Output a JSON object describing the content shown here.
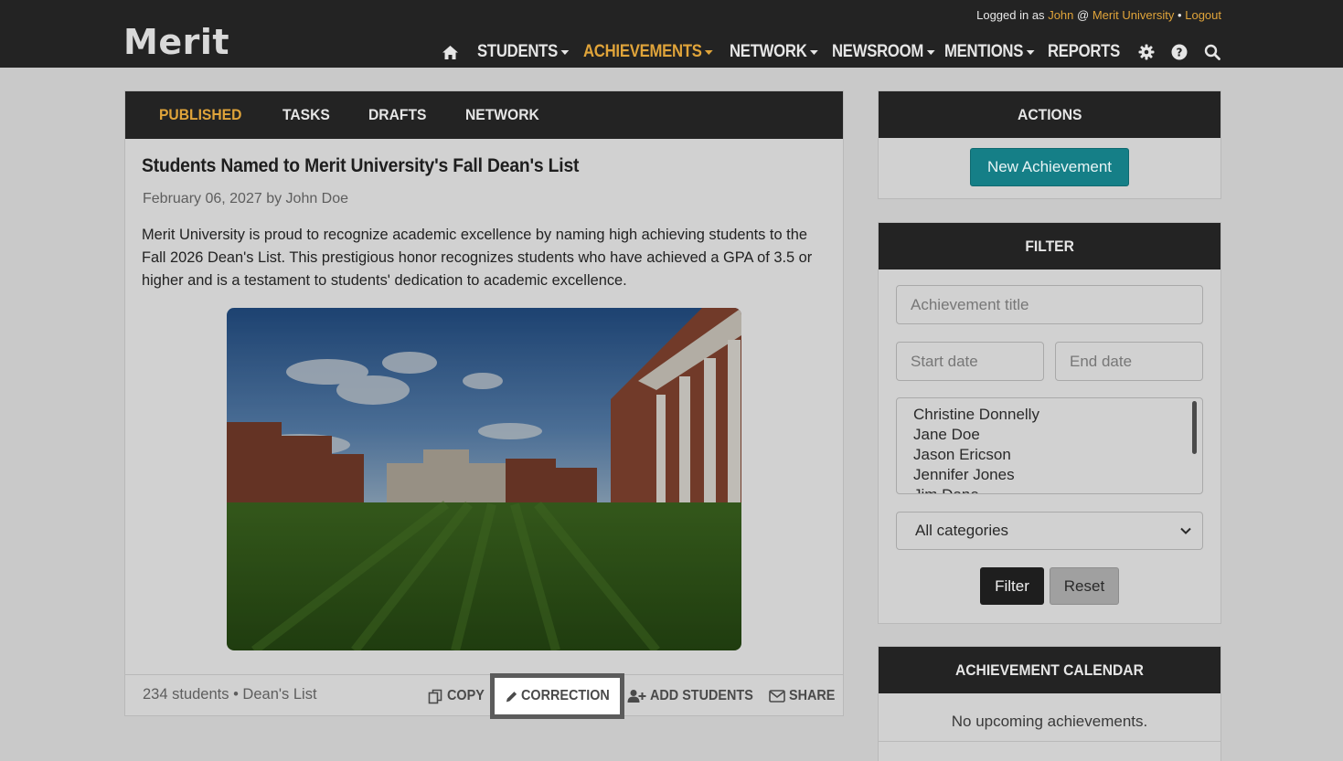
{
  "header": {
    "logo": "Merit",
    "user_prefix": "Logged in as",
    "user_name": "John",
    "at": "@",
    "org_name": "Merit University",
    "separator": "•",
    "logout": "Logout",
    "nav": [
      {
        "label": "STUDENTS",
        "dropdown": true
      },
      {
        "label": "ACHIEVEMENTS",
        "dropdown": true,
        "active": true
      },
      {
        "label": "NETWORK",
        "dropdown": true
      },
      {
        "label": "NEWSROOM",
        "dropdown": true
      },
      {
        "label": "MENTIONS",
        "dropdown": true
      },
      {
        "label": "REPORTS",
        "dropdown": false
      }
    ],
    "icons": [
      "home-icon",
      "gear-icon",
      "help-icon",
      "search-icon"
    ]
  },
  "main": {
    "tabs": [
      {
        "label": "PUBLISHED",
        "active": true
      },
      {
        "label": "TASKS"
      },
      {
        "label": "DRAFTS"
      },
      {
        "label": "NETWORK"
      }
    ],
    "article": {
      "title": "Students Named to Merit University's Fall Dean's List",
      "meta": "February 06, 2027 by John Doe",
      "body": "Merit University is proud to recognize academic excellence by naming high achieving students to the Fall 2026 Dean's List. This prestigious honor recognizes students who have achieved a GPA of 3.5 or higher and is a testament to students' dedication to academic excellence."
    },
    "footer": {
      "info": "234 students • Dean's List",
      "copy": "COPY",
      "correction": "CORRECTION",
      "add_students": "ADD STUDENTS",
      "share": "SHARE"
    }
  },
  "sidebar": {
    "actions": {
      "title": "ACTIONS",
      "new_button": "New Achievement"
    },
    "filter": {
      "title": "FILTER",
      "title_placeholder": "Achievement title",
      "start_placeholder": "Start date",
      "end_placeholder": "End date",
      "people": [
        "Christine Donnelly",
        "Jane Doe",
        "Jason Ericson",
        "Jennifer Jones",
        "Jim Dane"
      ],
      "category": "All categories",
      "filter_button": "Filter",
      "reset_button": "Reset"
    },
    "calendar": {
      "title": "ACHIEVEMENT CALENDAR",
      "empty": "No upcoming achievements."
    }
  },
  "colors": {
    "accent": "#e0a43a",
    "teal": "#157f87",
    "dark": "#232323"
  }
}
